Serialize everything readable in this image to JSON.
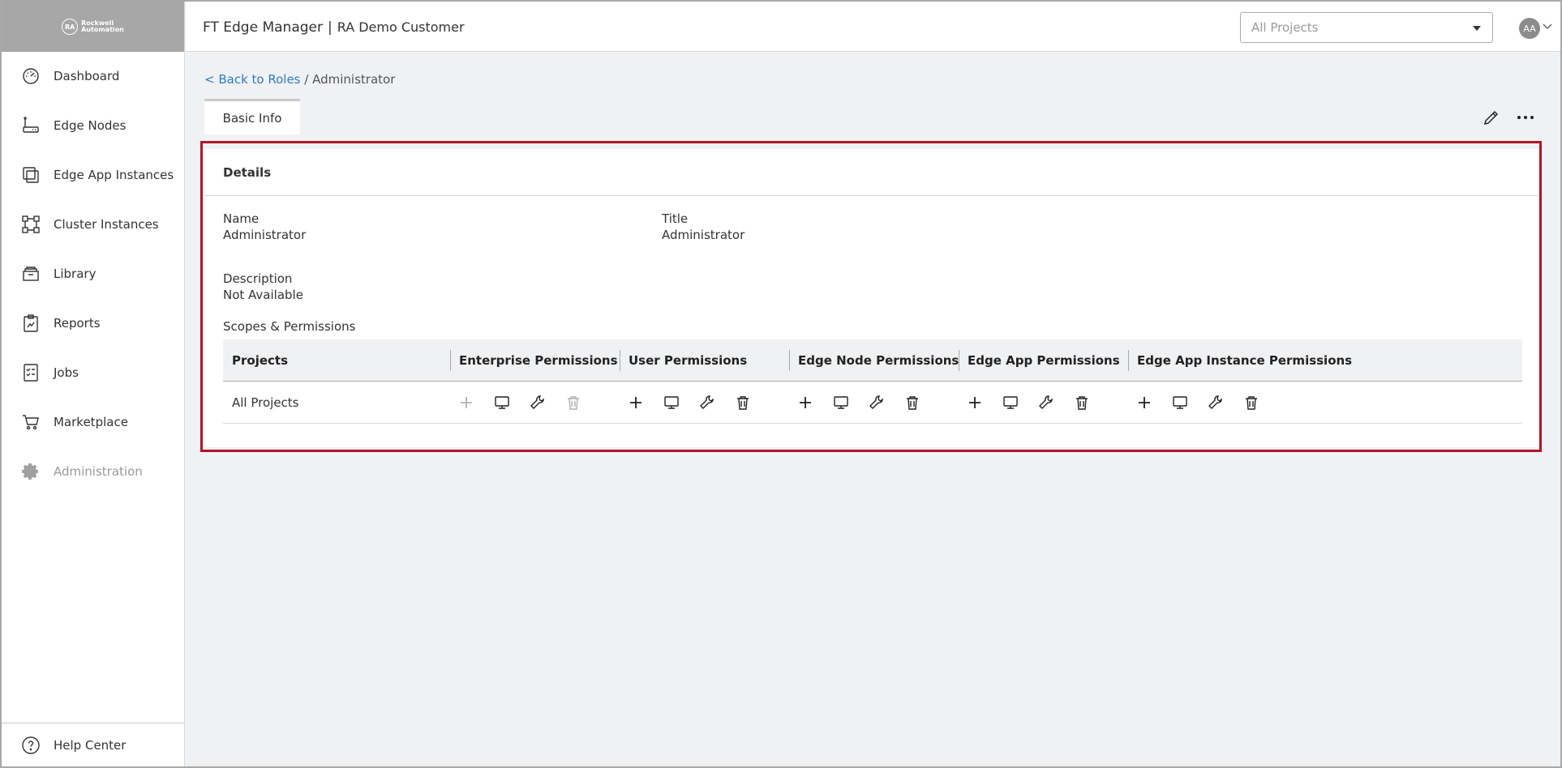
{
  "header": {
    "app_title": "FT Edge Manager",
    "separator": "|",
    "customer": "RA Demo Customer",
    "project_select_value": "All Projects",
    "avatar_initials": "AA"
  },
  "logo": {
    "mark": "RA",
    "line1": "Rockwell",
    "line2": "Automation"
  },
  "sidebar": {
    "items": [
      {
        "label": "Dashboard",
        "icon": "dashboard-gauge-icon"
      },
      {
        "label": "Edge Nodes",
        "icon": "edge-node-router-icon"
      },
      {
        "label": "Edge App Instances",
        "icon": "app-instances-icon"
      },
      {
        "label": "Cluster Instances",
        "icon": "cluster-icon"
      },
      {
        "label": "Library",
        "icon": "library-box-icon"
      },
      {
        "label": "Reports",
        "icon": "reports-clipboard-icon"
      },
      {
        "label": "Jobs",
        "icon": "jobs-checklist-icon"
      },
      {
        "label": "Marketplace",
        "icon": "cart-icon"
      },
      {
        "label": "Administration",
        "icon": "gear-icon"
      }
    ],
    "help": "Help Center"
  },
  "breadcrumb": {
    "back_link": "< Back to Roles",
    "separator": "/",
    "current": "Administrator"
  },
  "tabs": {
    "basic_info": "Basic Info"
  },
  "details": {
    "section_title": "Details",
    "name_label": "Name",
    "name_value": "Administrator",
    "title_label": "Title",
    "title_value": "Administrator",
    "description_label": "Description",
    "description_value": "Not Available",
    "scopes_title": "Scopes & Permissions"
  },
  "permissions_table": {
    "columns": [
      "Projects",
      "Enterprise Permissions",
      "User Permissions",
      "Edge Node Permissions",
      "Edge App Permissions",
      "Edge App Instance Permissions"
    ],
    "rows": [
      {
        "project": "All Projects",
        "groups": [
          {
            "create": false,
            "view": true,
            "edit": true,
            "delete": false
          },
          {
            "create": true,
            "view": true,
            "edit": true,
            "delete": true
          },
          {
            "create": true,
            "view": true,
            "edit": true,
            "delete": true
          },
          {
            "create": true,
            "view": true,
            "edit": true,
            "delete": true
          },
          {
            "create": true,
            "view": true,
            "edit": true,
            "delete": true
          }
        ]
      }
    ]
  },
  "colors": {
    "highlight_border": "#b0152a",
    "link": "#2e7cc4",
    "logo_bg": "#a7a7a7"
  }
}
